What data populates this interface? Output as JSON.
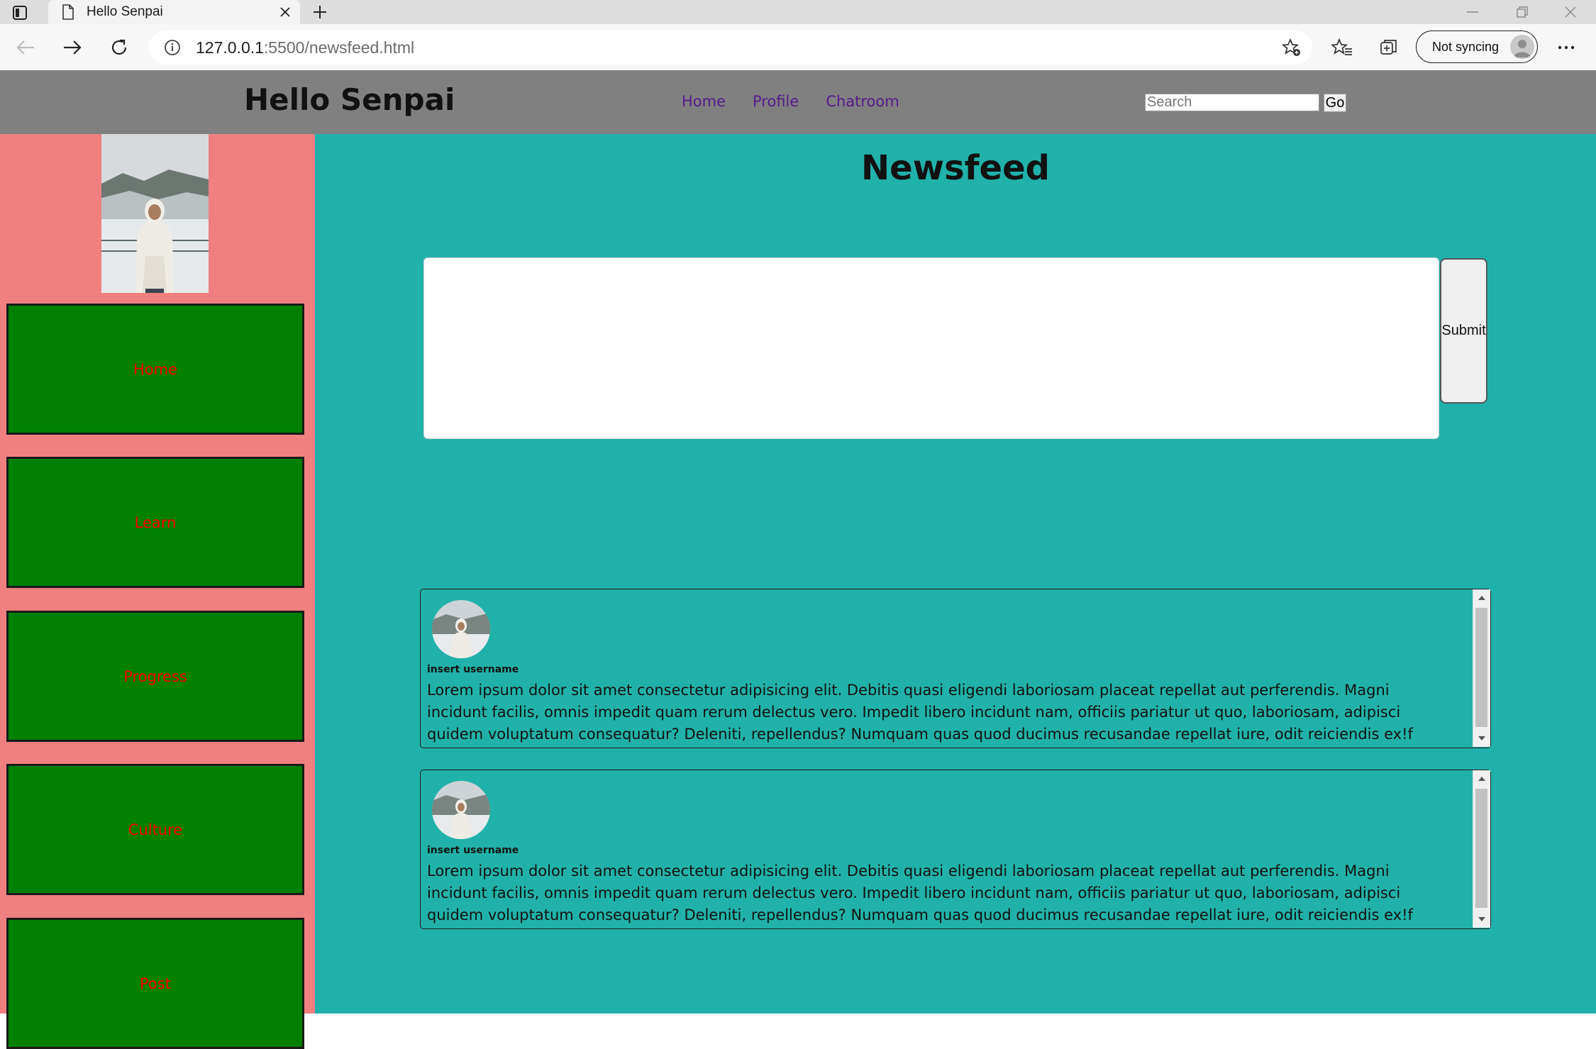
{
  "browser": {
    "tab_title": "Hello Senpai",
    "url_host": "127.0.0.1",
    "url_rest": ":5500/newsfeed.html",
    "sync_label": "Not syncing"
  },
  "header": {
    "site_title": "Hello Senpai",
    "nav": [
      "Home",
      "Profile",
      "Chatroom"
    ],
    "search_placeholder": "Search",
    "go_label": "Go"
  },
  "sidebar": {
    "items": [
      "Home",
      "Learn",
      "Progress",
      "Culture",
      "Post"
    ]
  },
  "main": {
    "heading": "Newsfeed",
    "post_input_value": "",
    "submit_label": "Submit",
    "posts": [
      {
        "username": "insert username",
        "text": "Lorem ipsum dolor sit amet consectetur adipisicing elit. Debitis quasi eligendi laboriosam placeat repellat aut perferendis. Magni incidunt facilis, omnis impedit quam rerum delectus vero. Impedit libero incidunt nam, officiis pariatur ut quo, laboriosam, adipisci quidem voluptatum consequatur? Deleniti, repellendus? Numquam quas quod ducimus recusandae repellat iure, odit reiciendis ex!f"
      },
      {
        "username": "insert username",
        "text": "Lorem ipsum dolor sit amet consectetur adipisicing elit. Debitis quasi eligendi laboriosam placeat repellat aut perferendis. Magni incidunt facilis, omnis impedit quam rerum delectus vero. Impedit libero incidunt nam, officiis pariatur ut quo, laboriosam, adipisci quidem voluptatum consequatur? Deleniti, repellendus? Numquam quas quod ducimus recusandae repellat iure, odit reiciendis ex!f"
      }
    ]
  },
  "colors": {
    "page_bg": "#20b2aa",
    "header_bg": "#808080",
    "sidebar_bg": "#f08080",
    "sidebar_button_bg": "#008000",
    "sidebar_button_text": "#ff0000",
    "nav_link": "#551a8b"
  },
  "icons": [
    "tab-actions-icon",
    "page-icon",
    "close-icon",
    "plus-icon",
    "back-icon",
    "forward-icon",
    "refresh-icon",
    "info-icon",
    "add-favorite-icon",
    "favorites-icon",
    "collections-icon",
    "profile-icon",
    "more-icon"
  ]
}
